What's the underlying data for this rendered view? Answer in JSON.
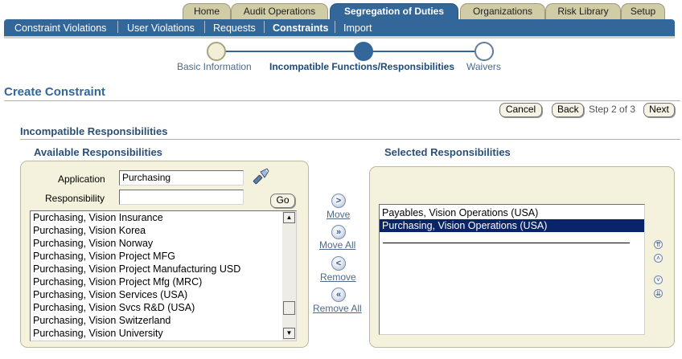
{
  "tabs": [
    {
      "label": "Home"
    },
    {
      "label": "Audit Operations"
    },
    {
      "label": "Segregation of Duties"
    },
    {
      "label": "Organizations"
    },
    {
      "label": "Risk Library"
    },
    {
      "label": "Setup"
    }
  ],
  "subnav": [
    {
      "label": "Constraint Violations"
    },
    {
      "label": "User Violations"
    },
    {
      "label": "Requests"
    },
    {
      "label": "Constraints"
    },
    {
      "label": "Import"
    }
  ],
  "train": [
    {
      "label": "Basic Information"
    },
    {
      "label": "Incompatible Functions/Responsibilities"
    },
    {
      "label": "Waivers"
    }
  ],
  "page_title": "Create Constraint",
  "actions": {
    "cancel": "Cancel",
    "back": "Back",
    "step": "Step 2 of 3",
    "next": "Next"
  },
  "section_title": "Incompatible Responsibilities",
  "available": {
    "title": "Available Responsibilities",
    "application_label": "Application",
    "application_value": "Purchasing",
    "responsibility_label": "Responsibility",
    "responsibility_value": "",
    "go": "Go",
    "items": [
      "Purchasing, Vision Insurance",
      "Purchasing, Vision Korea",
      "Purchasing, Vision Norway",
      "Purchasing, Vision Project MFG",
      "Purchasing, Vision Project Manufacturing USD",
      "Purchasing, Vision Project Mfg (MRC)",
      "Purchasing, Vision Services (USA)",
      "Purchasing, Vision Svcs R&D (USA)",
      "Purchasing, Vision Switzerland",
      "Purchasing, Vision University"
    ]
  },
  "shuttle": {
    "move": "Move",
    "move_all": "Move All",
    "remove": "Remove",
    "remove_all": "Remove All"
  },
  "selected": {
    "title": "Selected Responsibilities",
    "items": [
      "Payables, Vision Operations (USA)",
      "Purchasing, Vision Operations (USA)"
    ],
    "selected_index": 1
  },
  "colors": {
    "brand_blue": "#336699",
    "tab_tan": "#cfcca6",
    "panel_bg": "#f4f2dc",
    "selection": "#0a246a"
  }
}
